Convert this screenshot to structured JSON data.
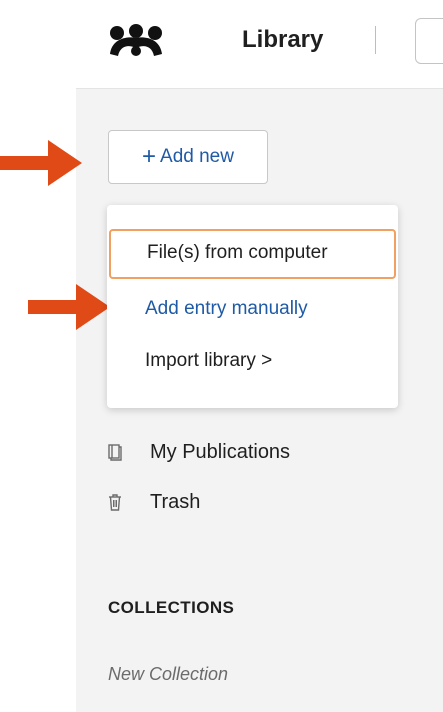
{
  "header": {
    "logo_icon": "mendeley-logo-icon",
    "title": "Library"
  },
  "toolbar": {
    "add_new_label": "Add new",
    "plus_icon": "+"
  },
  "add_menu": {
    "items": [
      {
        "label": "File(s) from computer",
        "state": "focused"
      },
      {
        "label": "Add entry manually",
        "state": "highlighted"
      },
      {
        "label": "Import library",
        "suffix": ">"
      }
    ]
  },
  "sidebar": {
    "items": [
      {
        "label": "My Publications",
        "icon": "publications-icon"
      },
      {
        "label": "Trash",
        "icon": "trash-icon"
      }
    ],
    "collections_heading": "COLLECTIONS",
    "new_collection_label": "New Collection"
  },
  "annotations": {
    "arrow_color": "#e04a17",
    "arrows": [
      "pointer-arrow-add-new",
      "pointer-arrow-add-entry"
    ]
  },
  "colors": {
    "accent_blue": "#1f5aa6",
    "focus_orange": "#f0a060",
    "sidebar_bg": "#f3f3f3"
  }
}
